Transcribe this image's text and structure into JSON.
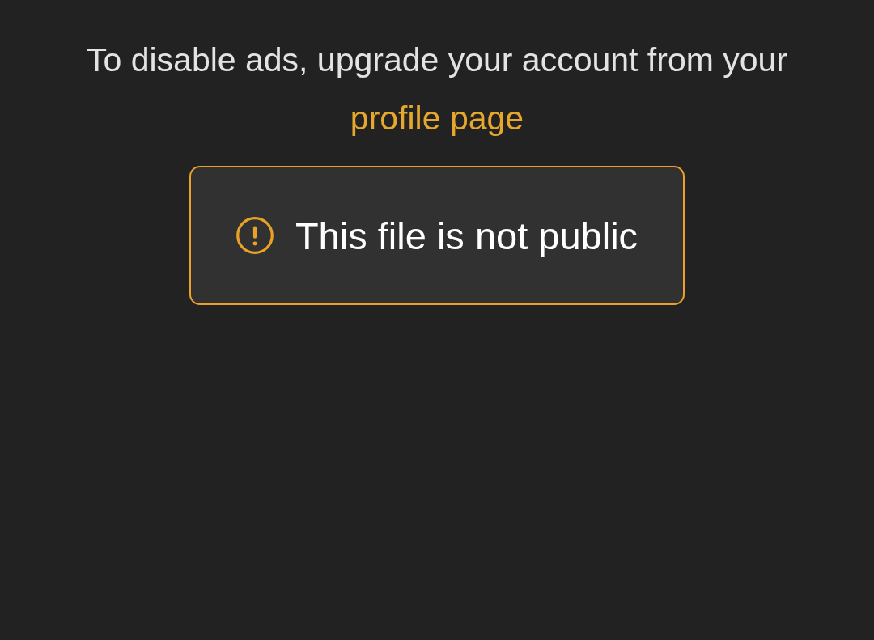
{
  "notice": {
    "text": "To disable ads, upgrade your account from your",
    "link": "profile page"
  },
  "alert": {
    "kind": "warning",
    "message": "This file is not public"
  }
}
